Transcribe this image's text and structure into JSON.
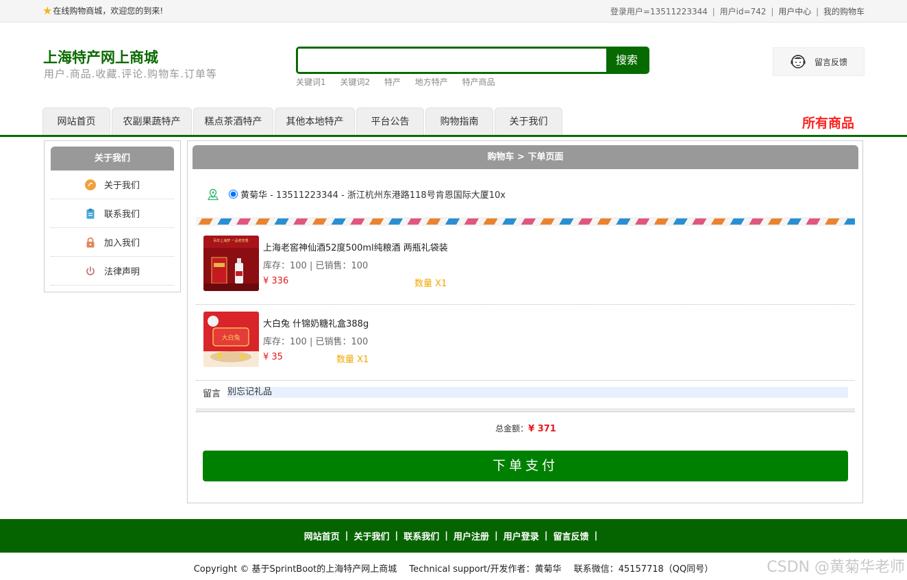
{
  "topbar": {
    "welcome": "在线购物商城，欢迎您的到来!",
    "login_user": "登录用户=13511223344",
    "user_id": "用户id=742",
    "user_center": "用户中心",
    "my_cart": "我的购物车",
    "separator": "|"
  },
  "header": {
    "title": "上海特产网上商城",
    "subtitle": "用户.商品.收藏.评论.购物车.订单等",
    "search": {
      "value": "",
      "placeholder": "",
      "button": "搜索"
    },
    "keywords": [
      "关键词1",
      "关键词2",
      "特产",
      "地方特产",
      "特产商品"
    ],
    "feedback": "留言反馈"
  },
  "nav": {
    "tabs": [
      {
        "label": "网站首页"
      },
      {
        "label": "农副果蔬特产"
      },
      {
        "label": "糕点茶酒特产"
      },
      {
        "label": "其他本地特产"
      },
      {
        "label": "平台公告"
      },
      {
        "label": "购物指南"
      },
      {
        "label": "关于我们"
      }
    ],
    "all_goods": "所有商品"
  },
  "sidebar": {
    "title": "关于我们",
    "items": [
      {
        "label": "关于我们",
        "icon": "orange-circle-icon"
      },
      {
        "label": "联系我们",
        "icon": "clipboard-icon"
      },
      {
        "label": "加入我们",
        "icon": "lock-icon"
      },
      {
        "label": "法律声明",
        "icon": "power-icon"
      }
    ]
  },
  "order": {
    "breadcrumb": "购物车 > 下单页面",
    "address": "黄菊华 - 13511223344 - 浙江杭州东港路118号肯恩国际大厦10x",
    "products": [
      {
        "name": "上海老窖神仙酒52度500ml纯粮酒 两瓶礼袋装",
        "stock": "库存：100 | 已销售：100",
        "price": "¥ 336",
        "qty": "数量 X1",
        "thumb_text": "百年上海梦 一品老窖香"
      },
      {
        "name": "大白兔 什锦奶糖礼盒388g",
        "stock": "库存：100 | 已销售：100",
        "price": "¥ 35",
        "qty": "数量 X1",
        "thumb_text": "大白兔"
      }
    ],
    "message_label": "留言",
    "message_value": "别忘记礼品",
    "total_label": "总金额：",
    "total_value": "¥ 371",
    "pay_button": "下单支付"
  },
  "footer": {
    "links": [
      "网站首页",
      "关于我们",
      "联系我们",
      "用户注册",
      "用户登录",
      "留言反馈"
    ],
    "bar": "|",
    "copyright": "Copyright © 基于SprintBoot的上海特产网上商城",
    "support": "Technical support/开发作者：黄菊华",
    "contact": "联系微信：45157718（QQ同号）"
  },
  "watermark": "CSDN @黄菊华老师",
  "colors": {
    "brand_green": "#066a00",
    "pay_green": "#008000",
    "price_red": "#e81818",
    "qty_orange": "#f0a800",
    "all_goods_red": "#ff2121"
  }
}
